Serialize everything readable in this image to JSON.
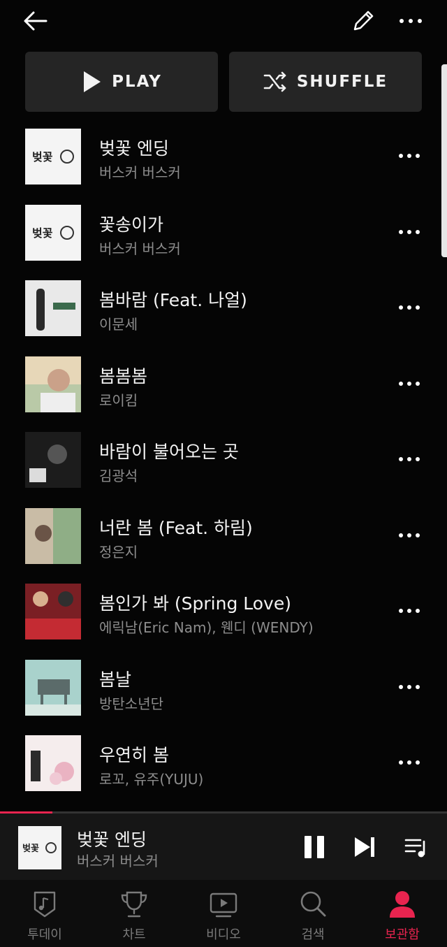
{
  "header": {
    "play_label": "PLAY",
    "shuffle_label": "SHUFFLE"
  },
  "songs": [
    {
      "title": "벚꽃 엔딩",
      "artist": "버스커 버스커"
    },
    {
      "title": "꽃송이가",
      "artist": "버스커 버스커"
    },
    {
      "title": "봄바람 (Feat. 나얼)",
      "artist": "이문세"
    },
    {
      "title": "봄봄봄",
      "artist": "로이킴"
    },
    {
      "title": "바람이 불어오는 곳",
      "artist": "김광석"
    },
    {
      "title": "너란 봄 (Feat. 하림)",
      "artist": "정은지"
    },
    {
      "title": "봄인가 봐 (Spring Love)",
      "artist": "에릭남(Eric Nam), 웬디 (WENDY)"
    },
    {
      "title": "봄날",
      "artist": "방탄소년단"
    },
    {
      "title": "우연히 봄",
      "artist": "로꼬, 유주(YUJU)"
    }
  ],
  "now_playing": {
    "title": "벚꽃 엔딩",
    "artist": "버스커 버스커",
    "progress": 0.117
  },
  "tabs": [
    {
      "label": "투데이",
      "icon": "music-note-icon",
      "active": false
    },
    {
      "label": "차트",
      "icon": "trophy-icon",
      "active": false
    },
    {
      "label": "비디오",
      "icon": "video-play-icon",
      "active": false
    },
    {
      "label": "검색",
      "icon": "search-icon",
      "active": false
    },
    {
      "label": "보관함",
      "icon": "person-icon",
      "active": true
    }
  ],
  "colors": {
    "accent": "#e8244f",
    "background": "#050505",
    "button": "#252525"
  }
}
